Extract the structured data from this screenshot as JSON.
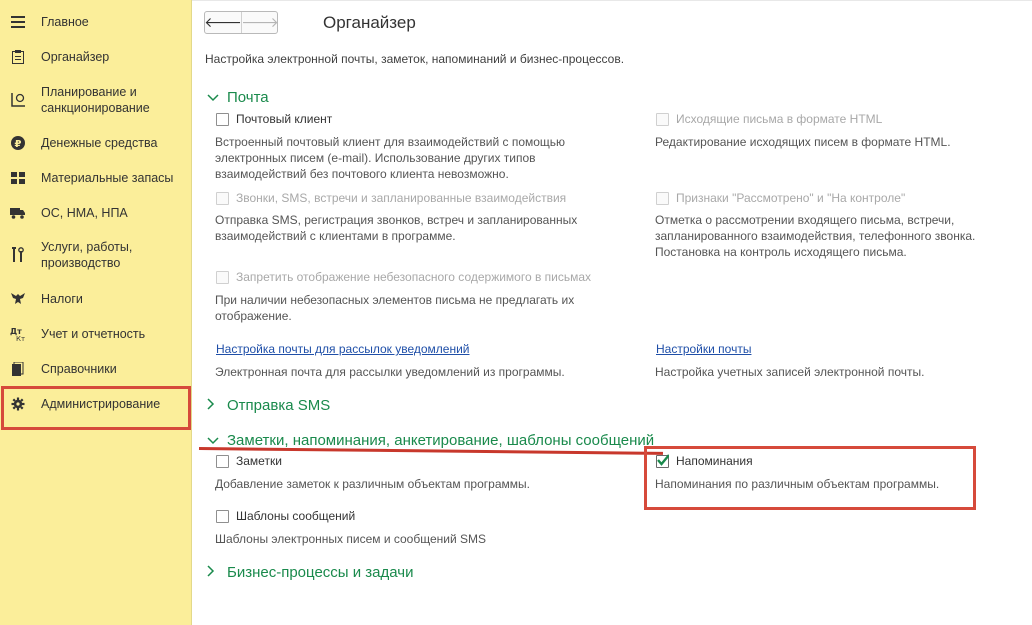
{
  "sidebar": {
    "items": [
      {
        "label": "Главное",
        "icon": "menu-icon"
      },
      {
        "label": "Органайзер",
        "icon": "clipboard-icon"
      },
      {
        "label": "Планирование и\nсанкционирование",
        "icon": "planning-icon"
      },
      {
        "label": "Денежные средства",
        "icon": "ruble-icon"
      },
      {
        "label": "Материальные запасы",
        "icon": "grid-icon"
      },
      {
        "label": "ОС, НМА, НПА",
        "icon": "truck-icon"
      },
      {
        "label": "Услуги, работы,\nпроизводство",
        "icon": "tools-icon"
      },
      {
        "label": "Налоги",
        "icon": "eagle-icon"
      },
      {
        "label": "Учет и отчетность",
        "icon": "accounting-icon"
      },
      {
        "label": "Справочники",
        "icon": "books-icon"
      },
      {
        "label": "Администрирование",
        "icon": "gear-icon"
      }
    ]
  },
  "header": {
    "title": "Органайзер",
    "description": "Настройка электронной почты, заметок, напоминаний и бизнес-процессов."
  },
  "mail": {
    "title": "Почта",
    "mail_client_label": "Почтовый клиент",
    "mail_client_desc": "Встроенный почтовый клиент для взаимодействий с помощью\nэлектронных писем (e-mail). Использование других типов\nвзаимодействий без почтового клиента невозможно.",
    "html_label": "Исходящие письма в формате HTML",
    "html_desc": "Редактирование исходящих писем в формате HTML.",
    "calls_label": "Звонки, SMS, встречи и запланированные взаимодействия",
    "calls_desc": "Отправка SMS, регистрация звонков, встреч и запланированных\nвзаимодействий с клиентами в программе.",
    "reviewed_label": "Признаки \"Рассмотрено\" и \"На контроле\"",
    "reviewed_desc": "Отметка о рассмотрении входящего письма, встречи,\nзапланированного взаимодействия, телефонного звонка.\nПостановка на контроль исходящего письма.",
    "unsafe_label": "Запретить отображение небезопасного содержимого в письмах",
    "unsafe_desc": "При наличии небезопасных элементов письма не предлагать их\nотображение.",
    "notify_link": "Настройка почты для рассылок уведомлений",
    "notify_desc": "Электронная почта для рассылки уведомлений из программы.",
    "settings_link": "Настройки почты",
    "settings_desc": "Настройка учетных записей электронной почты."
  },
  "sms": {
    "title": "Отправка SMS"
  },
  "notes": {
    "title": "Заметки, напоминания, анкетирование, шаблоны сообщений",
    "notes_label": "Заметки",
    "notes_desc": "Добавление заметок к различным объектам программы.",
    "reminders_label": "Напоминания",
    "reminders_desc": "Напоминания по различным объектам программы.",
    "templates_label": "Шаблоны сообщений",
    "templates_desc": "Шаблоны электронных писем и сообщений SMS"
  },
  "bp": {
    "title": "Бизнес-процессы и задачи"
  },
  "colors": {
    "accent": "#1a8a4c",
    "sidebar": "#fbee9a",
    "highlight": "#d64a3b",
    "link": "#1f4fa8"
  }
}
